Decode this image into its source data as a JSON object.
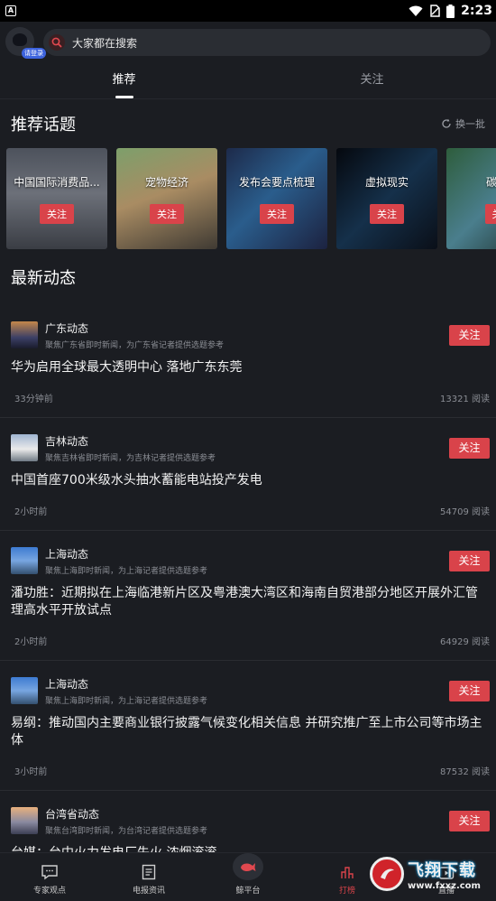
{
  "status": {
    "time": "2:23",
    "app_badge": "A"
  },
  "header": {
    "login_badge": "请登录",
    "search_placeholder": "大家都在搜索"
  },
  "tabs": [
    {
      "label": "推荐"
    },
    {
      "label": "关注"
    }
  ],
  "topics_section": {
    "title": "推荐话题",
    "refresh_label": "换一批",
    "items": [
      {
        "label": "中国国际消费品...",
        "follow": "关注"
      },
      {
        "label": "宠物经济",
        "follow": "关注"
      },
      {
        "label": "发布会要点梳理",
        "follow": "关注"
      },
      {
        "label": "虚拟现实",
        "follow": "关注"
      },
      {
        "label": "碳中",
        "follow": "关"
      }
    ]
  },
  "news_section": {
    "title": "最新动态",
    "items": [
      {
        "source": "广东动态",
        "desc": "聚焦广东省即时新闻，为广东省记者提供选题参考",
        "follow": "关注",
        "title": "华为启用全球最大透明中心 落地广东东莞",
        "time": "33分钟前",
        "reads": "13321 阅读"
      },
      {
        "source": "吉林动态",
        "desc": "聚焦吉林省即时新闻，为吉林记者提供选题参考",
        "follow": "关注",
        "title": "中国首座700米级水头抽水蓄能电站投产发电",
        "time": "2小时前",
        "reads": "54709 阅读"
      },
      {
        "source": "上海动态",
        "desc": "聚焦上海即时新闻，为上海记者提供选题参考",
        "follow": "关注",
        "title": "潘功胜：近期拟在上海临港新片区及粤港澳大湾区和海南自贸港部分地区开展外汇管理高水平开放试点",
        "time": "2小时前",
        "reads": "64929 阅读"
      },
      {
        "source": "上海动态",
        "desc": "聚焦上海即时新闻，为上海记者提供选题参考",
        "follow": "关注",
        "title": "易纲：推动国内主要商业银行披露气候变化相关信息 并研究推广至上市公司等市场主体",
        "time": "3小时前",
        "reads": "87532 阅读"
      },
      {
        "source": "台湾省动态",
        "desc": "聚焦台湾即时新闻，为台湾记者提供选题参考",
        "follow": "关注",
        "title": "台媒：台中火力发电厂失火 浓烟滚滚",
        "time": "",
        "reads": ""
      }
    ]
  },
  "bottom_nav": [
    {
      "label": "专家观点",
      "icon": "chat-icon"
    },
    {
      "label": "电报资讯",
      "icon": "document-icon"
    },
    {
      "label": "鲸平台",
      "icon": "whale-icon"
    },
    {
      "label": "打榜",
      "icon": "rank-icon"
    },
    {
      "label": "直播",
      "icon": "live-icon"
    }
  ],
  "watermark": {
    "title": "飞翔下载",
    "url": "www.fxxz.com"
  },
  "colors": {
    "accent": "#d9434a",
    "background": "#1b1d22"
  }
}
